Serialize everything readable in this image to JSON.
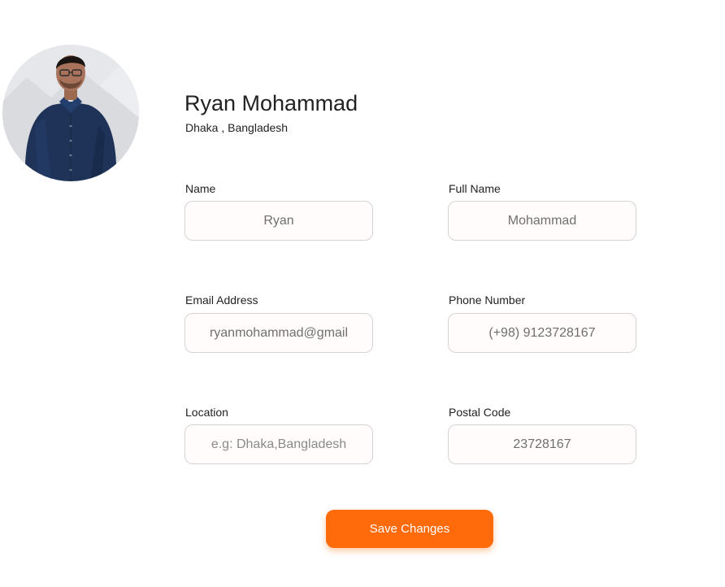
{
  "profile": {
    "name": "Ryan Mohammad",
    "location": "Dhaka , Bangladesh",
    "avatar_icon": "profile-photo"
  },
  "form": {
    "first_name": {
      "label": "Name",
      "value": "Ryan",
      "placeholder": ""
    },
    "full_name": {
      "label": "Full Name",
      "value": "Mohammad",
      "placeholder": ""
    },
    "email": {
      "label": "Email Address",
      "value": "ryanmohammad@gmail",
      "placeholder": ""
    },
    "phone": {
      "label": "Phone Number",
      "value": "(+98) 9123728167",
      "placeholder": ""
    },
    "location": {
      "label": "Location",
      "value": "",
      "placeholder": "e.g: Dhaka,Bangladesh"
    },
    "postal_code": {
      "label": "Postal Code",
      "value": "23728167",
      "placeholder": ""
    }
  },
  "actions": {
    "save_label": "Save Changes"
  },
  "colors": {
    "accent": "#ff6a0a",
    "input_border": "#d6d3d3",
    "input_background": "#fffcfb",
    "text": "#222222"
  }
}
